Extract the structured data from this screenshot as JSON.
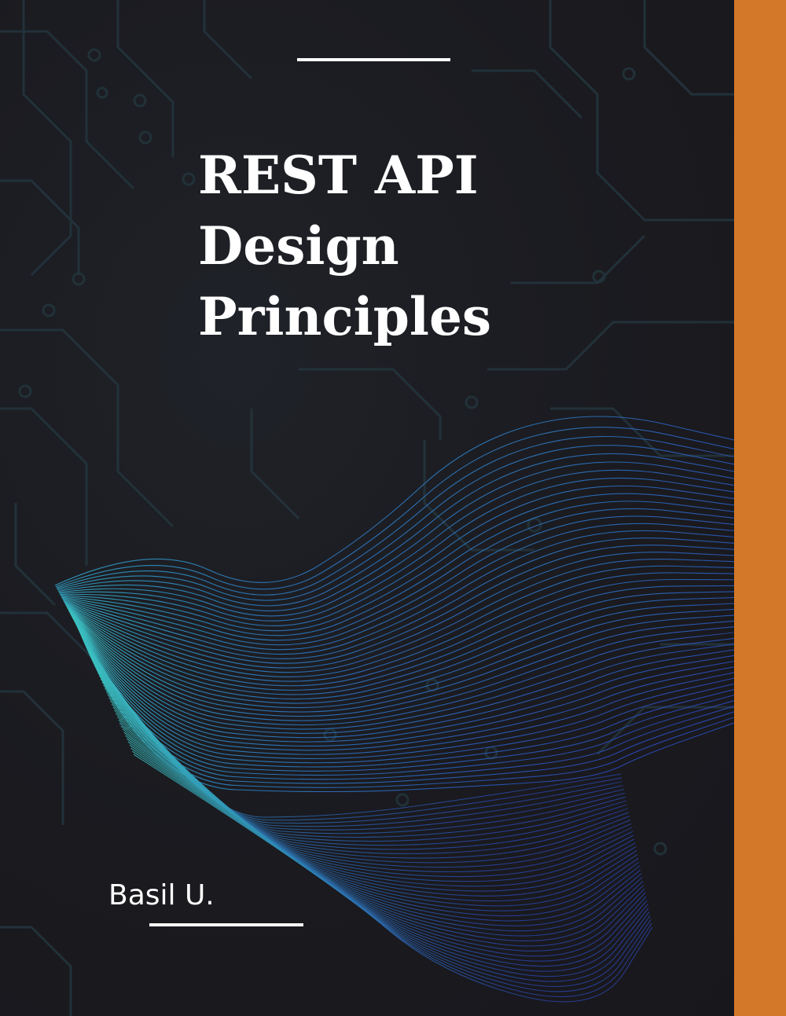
{
  "cover": {
    "title_lines": [
      "REST API",
      "Design",
      "Principles"
    ],
    "author": "Basil U."
  },
  "colors": {
    "background": "#1b1a20",
    "accent_stripe": "#d37828",
    "circuit_lines": "#23343c",
    "wave_start": "#3fd4d0",
    "wave_end": "#2b4ab8",
    "text": "#ffffff"
  },
  "decorations": {
    "background_pattern": "circuit-board",
    "foreground_graphic": "wireframe-wave-ribbon"
  }
}
